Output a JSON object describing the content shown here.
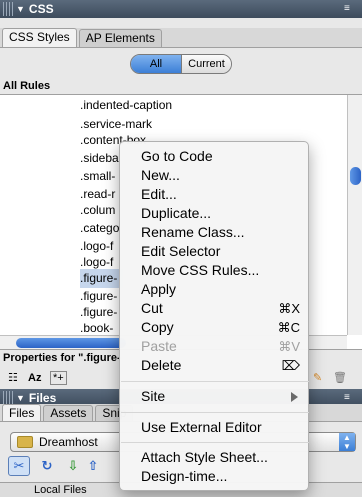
{
  "css_panel": {
    "title": "CSS",
    "tabs": [
      "CSS Styles",
      "AP Elements"
    ],
    "mode_buttons": [
      "All",
      "Current"
    ],
    "selected_mode": "All",
    "section_label": "All Rules",
    "rules": [
      ".indented-caption",
      ".service-mark",
      ".content-box",
      ".sideba",
      ".small-",
      ".read-r",
      ".colum",
      ".catego",
      ".logo-f",
      ".logo-f",
      ".figure-",
      ".figure-",
      ".figure-",
      ".book-"
    ],
    "selected_rule_index": 10,
    "properties_label": "Properties for \".figure-",
    "toolbar_text_icons": [
      "Az",
      "*+"
    ]
  },
  "files_panel": {
    "title": "Files",
    "tabs": [
      "Files",
      "Assets",
      "Snip"
    ],
    "site_name": "Dreamhost",
    "local_files_label": "Local Files"
  },
  "context_menu": {
    "items": [
      {
        "label": "Go to Code"
      },
      {
        "label": "New..."
      },
      {
        "label": "Edit..."
      },
      {
        "label": "Duplicate..."
      },
      {
        "label": "Rename Class..."
      },
      {
        "label": "Edit Selector"
      },
      {
        "label": "Move CSS Rules..."
      },
      {
        "label": "Apply"
      },
      {
        "label": "Cut",
        "shortcut": "⌘X"
      },
      {
        "label": "Copy",
        "shortcut": "⌘C"
      },
      {
        "label": "Paste",
        "shortcut": "⌘V",
        "disabled": true
      },
      {
        "label": "Delete",
        "shortcut": "⌦"
      },
      {
        "label": "Site",
        "submenu": true
      },
      {
        "label": "Use External Editor"
      },
      {
        "label": "Attach Style Sheet..."
      },
      {
        "label": "Design-time..."
      }
    ]
  },
  "colors": {
    "header_bg": "#4a596b",
    "selection_blue": "#3c7fd6",
    "rule_selection": "#c6d6ec"
  }
}
